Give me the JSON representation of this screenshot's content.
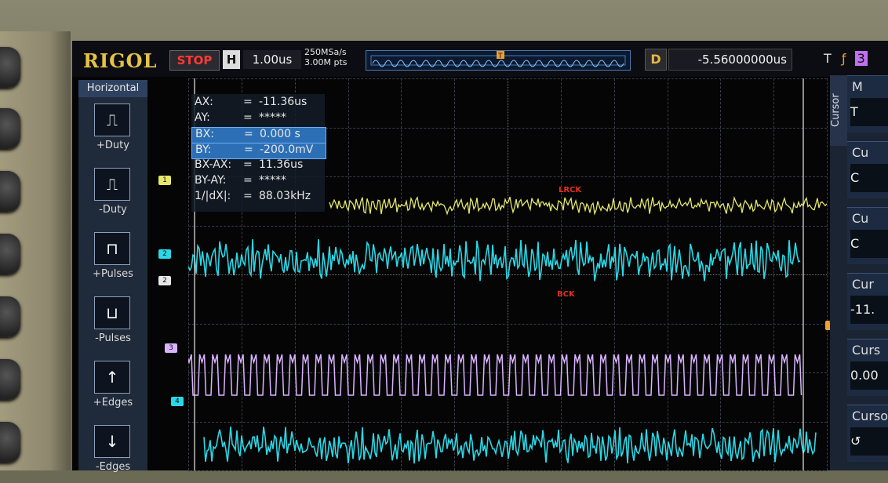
{
  "brand": "RIGOL",
  "topbar": {
    "run_state": "STOP",
    "timebase_icon": "H",
    "timebase": "1.00us",
    "sample_rate": "250MSa/s",
    "memory_depth": "3.00M pts",
    "trigger_marker": "T",
    "delay_icon": "D",
    "delay": "-5.56000000us",
    "trigger_icon": "T",
    "trigger_edge_symbol": "ƒ",
    "trigger_source": "3"
  },
  "left_menu": {
    "title": "Horizontal",
    "items": [
      {
        "label": "+Duty",
        "icon": "positive-duty-icon",
        "glyph": "⎍"
      },
      {
        "label": "-Duty",
        "icon": "negative-duty-icon",
        "glyph": "⎍"
      },
      {
        "label": "+Pulses",
        "icon": "positive-pulses-icon",
        "glyph": "⊓"
      },
      {
        "label": "-Pulses",
        "icon": "negative-pulses-icon",
        "glyph": "⊔"
      },
      {
        "label": "+Edges",
        "icon": "positive-edges-icon",
        "glyph": "↑"
      },
      {
        "label": "-Edges",
        "icon": "negative-edges-icon",
        "glyph": "↓"
      }
    ]
  },
  "cursor_readout": [
    {
      "key": "AX:",
      "eq": "=",
      "value": "-11.36us",
      "highlight": false
    },
    {
      "key": "AY:",
      "eq": "=",
      "value": "*****",
      "highlight": false
    },
    {
      "key": "BX:",
      "eq": "=",
      "value": "0.000 s",
      "highlight": true
    },
    {
      "key": "BY:",
      "eq": "=",
      "value": "-200.0mV",
      "highlight": true
    },
    {
      "key": "BX-AX:",
      "eq": "=",
      "value": "11.36us",
      "highlight": false
    },
    {
      "key": "BY-AY:",
      "eq": "=",
      "value": "*****",
      "highlight": false
    },
    {
      "key": "1/|dX|:",
      "eq": "=",
      "value": "88.03kHz",
      "highlight": false
    }
  ],
  "annotations": {
    "lrck": "LRCK",
    "bck": "BCK"
  },
  "channels": [
    {
      "id": "1",
      "color": "#e6e86a"
    },
    {
      "id": "2",
      "color": "#2ad8e6"
    },
    {
      "id": "3",
      "color": "#d9b3ff"
    },
    {
      "id": "4",
      "color": "#2ad8e6"
    }
  ],
  "right_menu": {
    "title": "Cursor",
    "items": [
      {
        "heading": "M",
        "value": "T"
      },
      {
        "heading": "Cu",
        "value": "C"
      },
      {
        "heading": "Cu",
        "value": "C"
      },
      {
        "heading": "Cur",
        "value": "-11."
      },
      {
        "heading": "Curs",
        "value": "0.00"
      },
      {
        "heading": "Curso",
        "value": "↺"
      }
    ]
  },
  "trigger_level_marker": "T"
}
